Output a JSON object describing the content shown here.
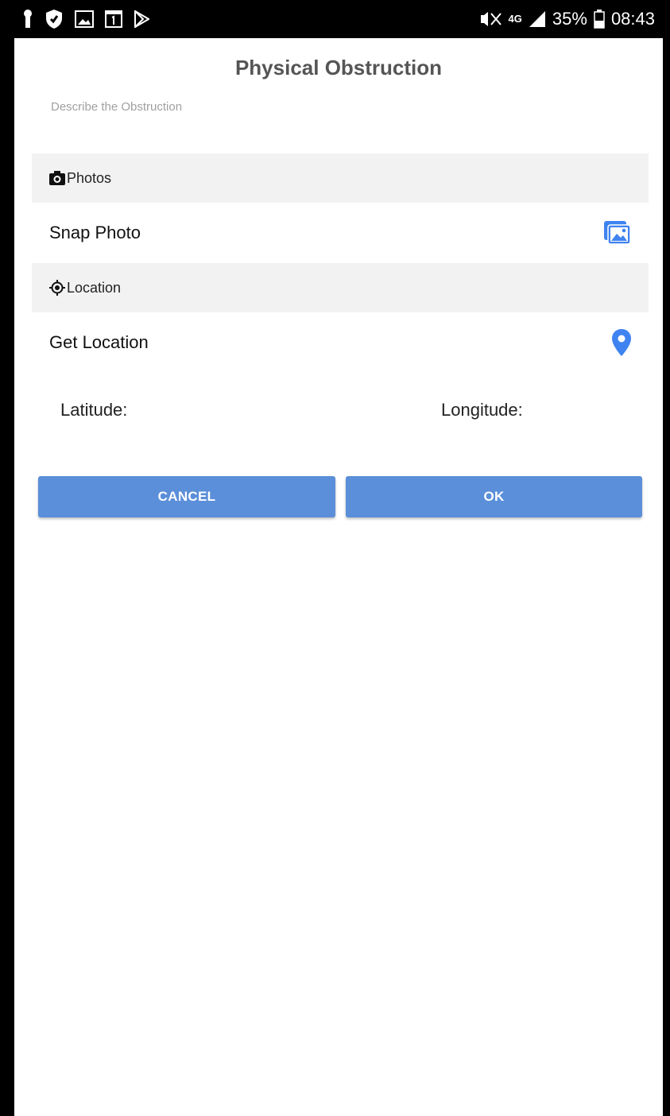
{
  "status_bar": {
    "network": "4G",
    "battery": "35%",
    "time": "08:43",
    "icons_left": [
      "keyhole-icon",
      "shield-icon",
      "image-icon",
      "calendar-icon",
      "play-store-icon"
    ],
    "icons_right": [
      "mute-icon",
      "signal-icon",
      "battery-icon"
    ]
  },
  "dialog": {
    "title": "Physical Obstruction",
    "description_placeholder": "Describe the Obstruction",
    "photos": {
      "header": "Photos",
      "header_icon": "camera-icon",
      "action": "Snap Photo",
      "action_icon": "gallery-icon"
    },
    "location": {
      "header": "Location",
      "header_icon": "gps-target-icon",
      "action": "Get Location",
      "action_icon": "map-pin-icon",
      "latitude_label": "Latitude:",
      "longitude_label": "Longitude:"
    },
    "buttons": {
      "cancel": "CANCEL",
      "ok": "OK"
    }
  },
  "colors": {
    "accent": "#5b8fd9",
    "icon_blue": "#3f83f0",
    "section_bg": "#f2f2f2",
    "status_bar": "#000000"
  }
}
